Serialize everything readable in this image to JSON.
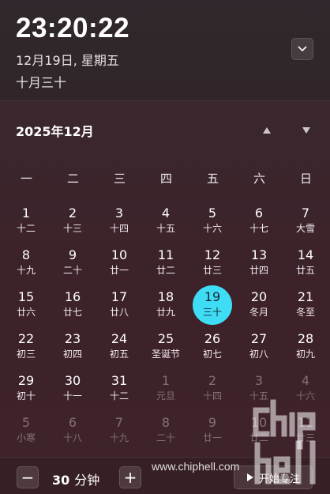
{
  "header": {
    "time": "23:20:22",
    "date": "12月19日, 星期五",
    "lunar_date": "十月三十"
  },
  "calendar": {
    "month_title": "2025年12月",
    "weekdays": [
      "一",
      "二",
      "三",
      "四",
      "五",
      "六",
      "日"
    ],
    "days": [
      {
        "num": "1",
        "lunar": "十二",
        "dim": false
      },
      {
        "num": "2",
        "lunar": "十三",
        "dim": false
      },
      {
        "num": "3",
        "lunar": "十四",
        "dim": false
      },
      {
        "num": "4",
        "lunar": "十五",
        "dim": false
      },
      {
        "num": "5",
        "lunar": "十六",
        "dim": false
      },
      {
        "num": "6",
        "lunar": "十七",
        "dim": false
      },
      {
        "num": "7",
        "lunar": "大雪",
        "dim": false
      },
      {
        "num": "8",
        "lunar": "十九",
        "dim": false
      },
      {
        "num": "9",
        "lunar": "二十",
        "dim": false
      },
      {
        "num": "10",
        "lunar": "廿一",
        "dim": false
      },
      {
        "num": "11",
        "lunar": "廿二",
        "dim": false
      },
      {
        "num": "12",
        "lunar": "廿三",
        "dim": false
      },
      {
        "num": "13",
        "lunar": "廿四",
        "dim": false
      },
      {
        "num": "14",
        "lunar": "廿五",
        "dim": false
      },
      {
        "num": "15",
        "lunar": "廿六",
        "dim": false
      },
      {
        "num": "16",
        "lunar": "廿七",
        "dim": false
      },
      {
        "num": "17",
        "lunar": "廿八",
        "dim": false
      },
      {
        "num": "18",
        "lunar": "廿九",
        "dim": false
      },
      {
        "num": "19",
        "lunar": "三十",
        "dim": false,
        "today": true
      },
      {
        "num": "20",
        "lunar": "冬月",
        "dim": false
      },
      {
        "num": "21",
        "lunar": "冬至",
        "dim": false
      },
      {
        "num": "22",
        "lunar": "初三",
        "dim": false
      },
      {
        "num": "23",
        "lunar": "初四",
        "dim": false
      },
      {
        "num": "24",
        "lunar": "初五",
        "dim": false
      },
      {
        "num": "25",
        "lunar": "圣诞节",
        "dim": false
      },
      {
        "num": "26",
        "lunar": "初七",
        "dim": false
      },
      {
        "num": "27",
        "lunar": "初八",
        "dim": false
      },
      {
        "num": "28",
        "lunar": "初九",
        "dim": false
      },
      {
        "num": "29",
        "lunar": "初十",
        "dim": false
      },
      {
        "num": "30",
        "lunar": "十一",
        "dim": false
      },
      {
        "num": "31",
        "lunar": "十二",
        "dim": false
      },
      {
        "num": "1",
        "lunar": "元旦",
        "dim": true
      },
      {
        "num": "2",
        "lunar": "十四",
        "dim": true
      },
      {
        "num": "3",
        "lunar": "十五",
        "dim": true
      },
      {
        "num": "4",
        "lunar": "十六",
        "dim": true
      },
      {
        "num": "5",
        "lunar": "小寒",
        "dim": true
      },
      {
        "num": "6",
        "lunar": "十八",
        "dim": true
      },
      {
        "num": "7",
        "lunar": "十九",
        "dim": true
      },
      {
        "num": "8",
        "lunar": "二十",
        "dim": true
      },
      {
        "num": "9",
        "lunar": "廿一",
        "dim": true
      },
      {
        "num": "10",
        "lunar": "廿二",
        "dim": true
      },
      {
        "num": "11",
        "lunar": "廿三",
        "dim": true
      }
    ]
  },
  "focus": {
    "duration_value": "30",
    "duration_unit": "分钟",
    "minus_label": "−",
    "plus_label": "+",
    "start_label": "开始专注"
  },
  "watermark": {
    "url": "www.chiphell.com",
    "logo_text": "chiphell"
  },
  "colors": {
    "today_highlight": "#3fdcf5",
    "background": "#3d2229"
  },
  "icons": {
    "collapse": "chevron-down-icon",
    "prev_month": "triangle-up-icon",
    "next_month": "triangle-down-icon",
    "play": "play-icon"
  }
}
